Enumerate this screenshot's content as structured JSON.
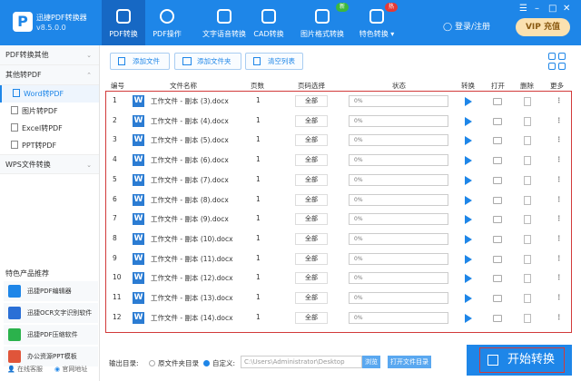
{
  "app": {
    "name": "迅捷PDF转换器",
    "version": "v8.5.0.0"
  },
  "nav": [
    {
      "label": "PDF转换",
      "active": true
    },
    {
      "label": "PDF操作"
    },
    {
      "label": "文字语音转换"
    },
    {
      "label": "CAD转换"
    },
    {
      "label": "图片格式转换",
      "badge": "新"
    },
    {
      "label": "特色转换 ▾",
      "badge": "热"
    }
  ],
  "header": {
    "login": "登录/注册",
    "vip": "VIP 充值"
  },
  "sidebar": {
    "groups": [
      "PDF转换其他",
      "其他转PDF",
      "WPS文件转换"
    ],
    "items": [
      "Word转PDF",
      "图片转PDF",
      "Excel转PDF",
      "PPT转PDF"
    ],
    "recommend": "特色产品推荐",
    "products": [
      "迅捷PDF编辑器",
      "迅捷OCR文字识别软件",
      "迅捷PDF压缩软件",
      "办公资源PPT模板"
    ],
    "footer": [
      "在线客服",
      "官网地址"
    ]
  },
  "toolbar": {
    "add_file": "添加文件",
    "add_folder": "添加文件夹",
    "clear": "清空列表"
  },
  "table": {
    "headers": [
      "编号",
      "文件名称",
      "页数",
      "页码选择",
      "状态",
      "转换",
      "打开",
      "删除",
      "更多"
    ],
    "rows": [
      {
        "no": "1",
        "name": "工作文件 - 副本 (3).docx",
        "pages": "1",
        "range": "全部",
        "status": "0%"
      },
      {
        "no": "2",
        "name": "工作文件 - 副本 (4).docx",
        "pages": "1",
        "range": "全部",
        "status": "0%"
      },
      {
        "no": "3",
        "name": "工作文件 - 副本 (5).docx",
        "pages": "1",
        "range": "全部",
        "status": "0%"
      },
      {
        "no": "4",
        "name": "工作文件 - 副本 (6).docx",
        "pages": "1",
        "range": "全部",
        "status": "0%"
      },
      {
        "no": "5",
        "name": "工作文件 - 副本 (7).docx",
        "pages": "1",
        "range": "全部",
        "status": "0%"
      },
      {
        "no": "6",
        "name": "工作文件 - 副本 (8).docx",
        "pages": "1",
        "range": "全部",
        "status": "0%"
      },
      {
        "no": "7",
        "name": "工作文件 - 副本 (9).docx",
        "pages": "1",
        "range": "全部",
        "status": "0%"
      },
      {
        "no": "8",
        "name": "工作文件 - 副本 (10).docx",
        "pages": "1",
        "range": "全部",
        "status": "0%"
      },
      {
        "no": "9",
        "name": "工作文件 - 副本 (11).docx",
        "pages": "1",
        "range": "全部",
        "status": "0%"
      },
      {
        "no": "10",
        "name": "工作文件 - 副本 (12).docx",
        "pages": "1",
        "range": "全部",
        "status": "0%"
      },
      {
        "no": "11",
        "name": "工作文件 - 副本 (13).docx",
        "pages": "1",
        "range": "全部",
        "status": "0%"
      },
      {
        "no": "12",
        "name": "工作文件 - 副本 (14).docx",
        "pages": "1",
        "range": "全部",
        "status": "0%"
      }
    ]
  },
  "output": {
    "label": "输出目录:",
    "opt_source": "原文件夹目录",
    "opt_custom": "自定义:",
    "path": "C:\\Users\\Administrator\\Desktop",
    "browse": "浏览",
    "open_dir": "打开文件目录",
    "selected": "custom"
  },
  "start": "开始转换",
  "colors": {
    "brand": "#1e86e8",
    "highlight": "#d23a3a"
  }
}
